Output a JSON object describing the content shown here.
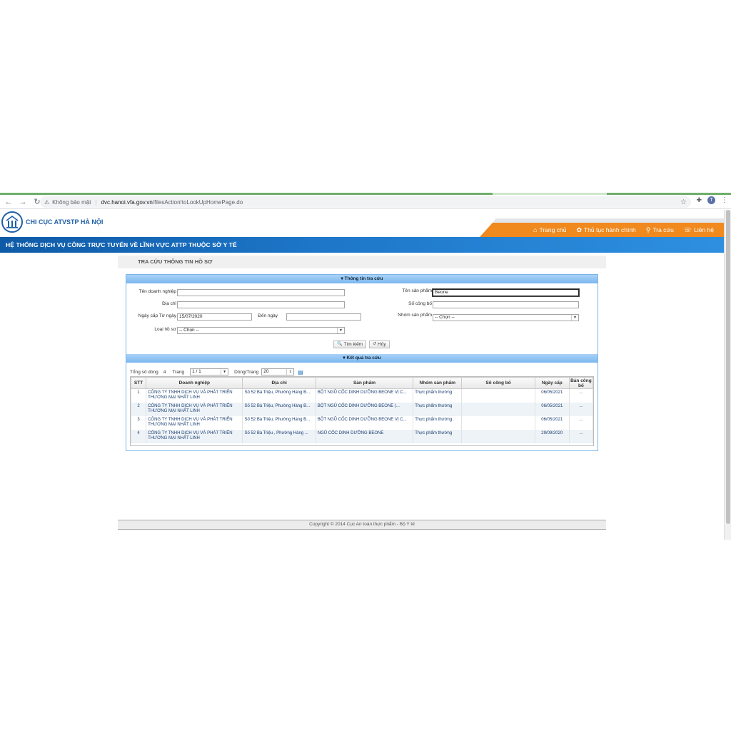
{
  "browser": {
    "security_label": "Không bảo mật",
    "url_host": "dvc.hanoi.vfa.gov.vn",
    "url_path": "/filesAction!toLookUpHomePage.do",
    "avatar_letter": "T"
  },
  "header": {
    "org_name": "CHI CỤC ATVSTP HÀ NỘI",
    "banner_title": "HỆ THỐNG DỊCH VỤ CÔNG TRỰC TUYẾN VỀ LĨNH VỰC ATTP THUỘC SỞ Y TẾ"
  },
  "nav": [
    {
      "label": "Trang chủ",
      "icon": "home-icon"
    },
    {
      "label": "Thủ tục hành chính",
      "icon": "gear-icon"
    },
    {
      "label": "Tra cứu",
      "icon": "search-icon"
    },
    {
      "label": "Liên hệ",
      "icon": "phone-icon"
    }
  ],
  "page_title": "TRA CỨU THÔNG TIN HỒ SƠ",
  "search": {
    "section_label": "Thông tin tra cứu",
    "company_label": "Tên doanh nghiệp",
    "company_value": "",
    "address_label": "Địa chỉ",
    "address_value": "",
    "from_date_label": "Ngày cấp Từ ngày",
    "from_date_value": "15/07/2020",
    "to_date_label": "Đến ngày",
    "to_date_value": "",
    "dossier_type_label": "Loại hồ sơ",
    "dossier_type_value": "-- Chọn --",
    "product_label": "Tên sản phẩm",
    "product_value": "Beone",
    "announce_no_label": "Số công bố",
    "announce_no_value": "",
    "product_group_label": "Nhóm sản phẩm",
    "product_group_value": "-- Chọn --",
    "search_button": "Tìm kiếm",
    "cancel_button": "Hủy"
  },
  "results": {
    "section_label": "Kết quả tra cứu",
    "total_label": "Tổng số dòng",
    "total_value": "4",
    "page_label": "Trang",
    "page_value": "1 / 1",
    "rows_per_page_label": "Dòng/Trang",
    "rows_per_page_value": "20",
    "columns": [
      "STT",
      "Doanh nghiệp",
      "Địa chỉ",
      "Sản phẩm",
      "Nhóm sản phẩm",
      "Số công bố",
      "Ngày cấp",
      "Bản công bố"
    ],
    "rows": [
      {
        "stt": "1",
        "company": "CÔNG TY TNHH DỊCH VỤ VÀ PHÁT TRIỂN THƯƠNG MẠI NHẤT LINH",
        "address": "Số 52 Bà Triệu, Phường Hàng B...",
        "product": "BỘT NGŨ CỐC DINH DƯỠNG BEONE VỊ C...",
        "group": "Thực phẩm thường",
        "announce_no": "",
        "date": "06/05/2021",
        "doc": "..."
      },
      {
        "stt": "2",
        "company": "CÔNG TY TNHH DỊCH VỤ VÀ PHÁT TRIỂN THƯƠNG MẠI NHẤT LINH",
        "address": "Số 52 Bà Triệu, Phường Hàng B...",
        "product": "BỘT NGŨ CỐC DINH DƯỠNG BEONE (...",
        "group": "Thực phẩm thường",
        "announce_no": "",
        "date": "06/05/2021",
        "doc": "..."
      },
      {
        "stt": "3",
        "company": "CÔNG TY TNHH DỊCH VỤ VÀ PHÁT TRIỂN THƯƠNG MẠI NHẤT LINH",
        "address": "Số 52 Bà Triệu, Phường Hàng B...",
        "product": "BỘT NGŨ CỐC DINH DƯỠNG BEONE VỊ C...",
        "group": "Thực phẩm thường",
        "announce_no": "",
        "date": "06/05/2021",
        "doc": "..."
      },
      {
        "stt": "4",
        "company": "CÔNG TY TNHH DỊCH VỤ VÀ PHÁT TRIỂN THƯƠNG MẠI NHẤT LINH",
        "address": "Số 52 Bà Triệu , Phường Hàng ...",
        "product": "NGŨ CỐC DINH DƯỠNG BEONE",
        "group": "Thực phẩm thường",
        "announce_no": "",
        "date": "29/09/2020",
        "doc": "..."
      }
    ]
  },
  "footer": "Copyright © 2014 Cục An toàn thực phẩm - Bộ Y tế",
  "colors": {
    "nav_orange": "#f0891e",
    "banner_blue": "#1e77c9",
    "brand_blue": "#1f5fa8"
  }
}
